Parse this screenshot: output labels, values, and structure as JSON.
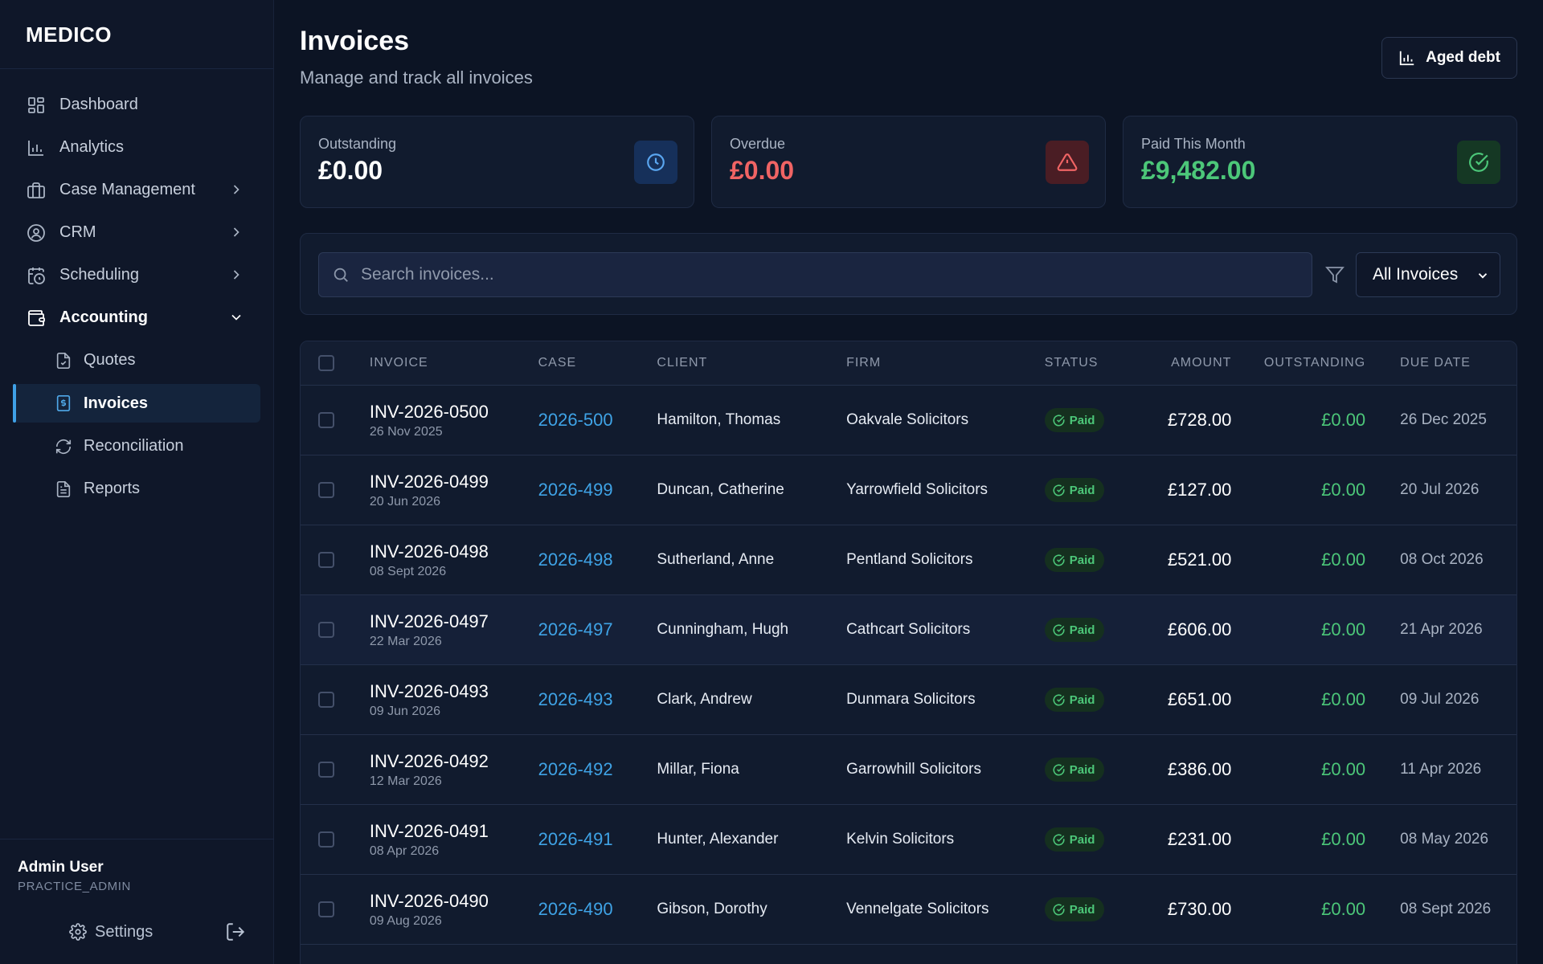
{
  "app": {
    "brand": "MEDICO"
  },
  "sidebar": {
    "items": [
      {
        "label": "Dashboard"
      },
      {
        "label": "Analytics"
      },
      {
        "label": "Case Management"
      },
      {
        "label": "CRM"
      },
      {
        "label": "Scheduling"
      },
      {
        "label": "Accounting"
      }
    ],
    "accounting_sub": [
      {
        "label": "Quotes"
      },
      {
        "label": "Invoices"
      },
      {
        "label": "Reconciliation"
      },
      {
        "label": "Reports"
      }
    ],
    "user": {
      "name": "Admin User",
      "role": "PRACTICE_ADMIN"
    },
    "settings_label": "Settings"
  },
  "header": {
    "title": "Invoices",
    "subtitle": "Manage and track all invoices",
    "aged_debt_label": "Aged debt"
  },
  "stats": [
    {
      "label": "Outstanding",
      "value": "£0.00",
      "color": "#ffffff"
    },
    {
      "label": "Overdue",
      "value": "£0.00",
      "color": "#f06464"
    },
    {
      "label": "Paid This Month",
      "value": "£9,482.00",
      "color": "#4cc779"
    }
  ],
  "filters": {
    "search_placeholder": "Search invoices...",
    "select_value": "All Invoices"
  },
  "table": {
    "columns": [
      "INVOICE",
      "CASE",
      "CLIENT",
      "FIRM",
      "STATUS",
      "AMOUNT",
      "OUTSTANDING",
      "DUE DATE"
    ],
    "rows": [
      {
        "invoice": "INV-2026-0500",
        "date": "26 Nov 2025",
        "case": "2026-500",
        "client": "Hamilton, Thomas",
        "firm": "Oakvale Solicitors",
        "status": "Paid",
        "amount": "£728.00",
        "outstanding": "£0.00",
        "due": "26 Dec 2025"
      },
      {
        "invoice": "INV-2026-0499",
        "date": "20 Jun 2026",
        "case": "2026-499",
        "client": "Duncan, Catherine",
        "firm": "Yarrowfield Solicitors",
        "status": "Paid",
        "amount": "£127.00",
        "outstanding": "£0.00",
        "due": "20 Jul 2026"
      },
      {
        "invoice": "INV-2026-0498",
        "date": "08 Sept 2026",
        "case": "2026-498",
        "client": "Sutherland, Anne",
        "firm": "Pentland Solicitors",
        "status": "Paid",
        "amount": "£521.00",
        "outstanding": "£0.00",
        "due": "08 Oct 2026"
      },
      {
        "invoice": "INV-2026-0497",
        "date": "22 Mar 2026",
        "case": "2026-497",
        "client": "Cunningham, Hugh",
        "firm": "Cathcart Solicitors",
        "status": "Paid",
        "amount": "£606.00",
        "outstanding": "£0.00",
        "due": "21 Apr 2026"
      },
      {
        "invoice": "INV-2026-0493",
        "date": "09 Jun 2026",
        "case": "2026-493",
        "client": "Clark, Andrew",
        "firm": "Dunmara Solicitors",
        "status": "Paid",
        "amount": "£651.00",
        "outstanding": "£0.00",
        "due": "09 Jul 2026"
      },
      {
        "invoice": "INV-2026-0492",
        "date": "12 Mar 2026",
        "case": "2026-492",
        "client": "Millar, Fiona",
        "firm": "Garrowhill Solicitors",
        "status": "Paid",
        "amount": "£386.00",
        "outstanding": "£0.00",
        "due": "11 Apr 2026"
      },
      {
        "invoice": "INV-2026-0491",
        "date": "08 Apr 2026",
        "case": "2026-491",
        "client": "Hunter, Alexander",
        "firm": "Kelvin Solicitors",
        "status": "Paid",
        "amount": "£231.00",
        "outstanding": "£0.00",
        "due": "08 May 2026"
      },
      {
        "invoice": "INV-2026-0490",
        "date": "09 Aug 2026",
        "case": "2026-490",
        "client": "Gibson, Dorothy",
        "firm": "Vennelgate Solicitors",
        "status": "Paid",
        "amount": "£730.00",
        "outstanding": "£0.00",
        "due": "08 Sept 2026"
      }
    ]
  }
}
